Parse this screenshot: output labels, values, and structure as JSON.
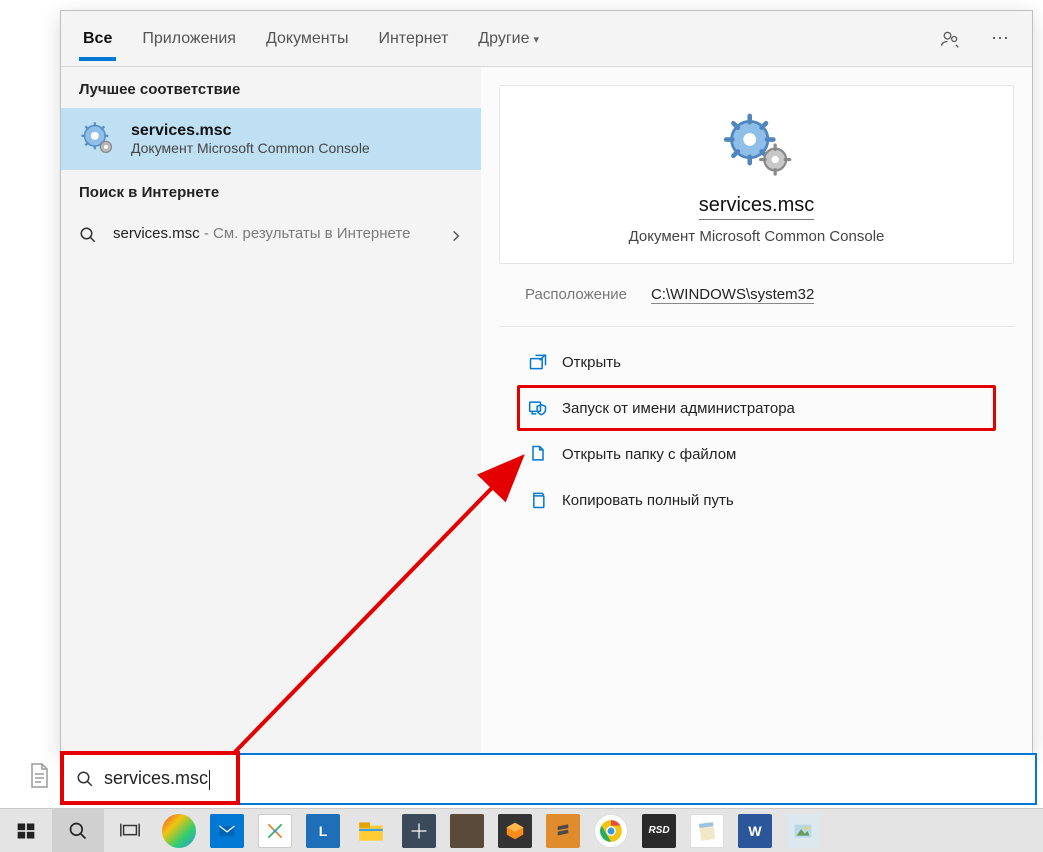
{
  "tabs": {
    "all": "Все",
    "apps": "Приложения",
    "docs": "Документы",
    "web": "Интернет",
    "more": "Другие"
  },
  "left": {
    "best_header": "Лучшее соответствие",
    "best_title": "services.msc",
    "best_sub": "Документ Microsoft Common Console",
    "web_header": "Поиск в Интернете",
    "web_query": "services.msc",
    "web_suffix": " - См. результаты в Интернете"
  },
  "preview": {
    "title": "services.msc",
    "sub": "Документ Microsoft Common Console",
    "location_label": "Расположение",
    "location_value": "C:\\WINDOWS\\system32"
  },
  "actions": {
    "open": "Открыть",
    "run_admin": "Запуск от имени администратора",
    "open_folder": "Открыть папку с файлом",
    "copy_path": "Копировать полный путь"
  },
  "search_value": "services.msc"
}
